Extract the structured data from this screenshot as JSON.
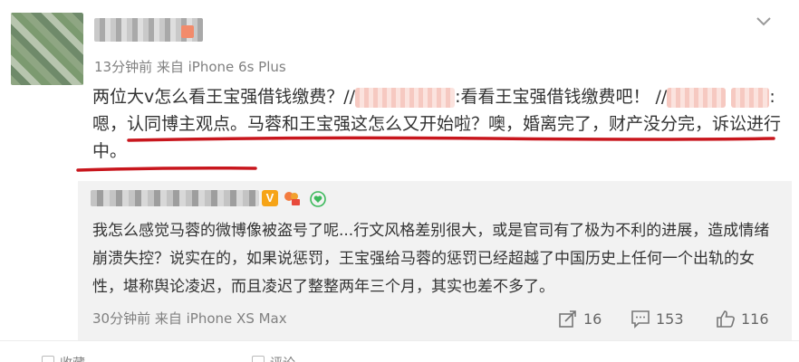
{
  "post": {
    "time": "13分钟前",
    "source": "来自 iPhone 6s Plus",
    "text_part1": "两位大v怎么看王宝强借钱缴费？//",
    "text_part2": ":看看王宝强借钱缴费吧！ //",
    "text_part3": ":嗯，认同博主观点。马蓉和王宝强这怎么又开始啦？噢，婚离完了，财产没分完，诉讼进行中。",
    "underline_color": "#c8161d"
  },
  "reply": {
    "badge_v": "V",
    "text": "我怎么感觉马蓉的微博像被盗号了呢...行文风格差别很大，或是官司有了极为不利的进展，造成情绪崩溃失控？说实在的，如果说惩罚，王宝强给马蓉的惩罚已经超越了中国历史上任何一个出轨的女性，堪称舆论凌迟，而且凌迟了整整两年三个月，其实也差不多了。",
    "time": "30分钟前",
    "source": "来自 iPhone XS Max",
    "repost_count": "16",
    "comment_count": "153",
    "like_count": "116"
  },
  "bottom": {
    "item1": "收藏",
    "item2": "评论"
  },
  "icons": {
    "menu": "chevron-down-icon",
    "repost": "repost-icon",
    "comment": "comment-icon",
    "like": "like-icon"
  },
  "colors": {
    "accent_underline": "#c8161d",
    "vip_badge": "#f6a417",
    "meta_text": "#808080",
    "reply_bg": "#f2f2f2"
  }
}
